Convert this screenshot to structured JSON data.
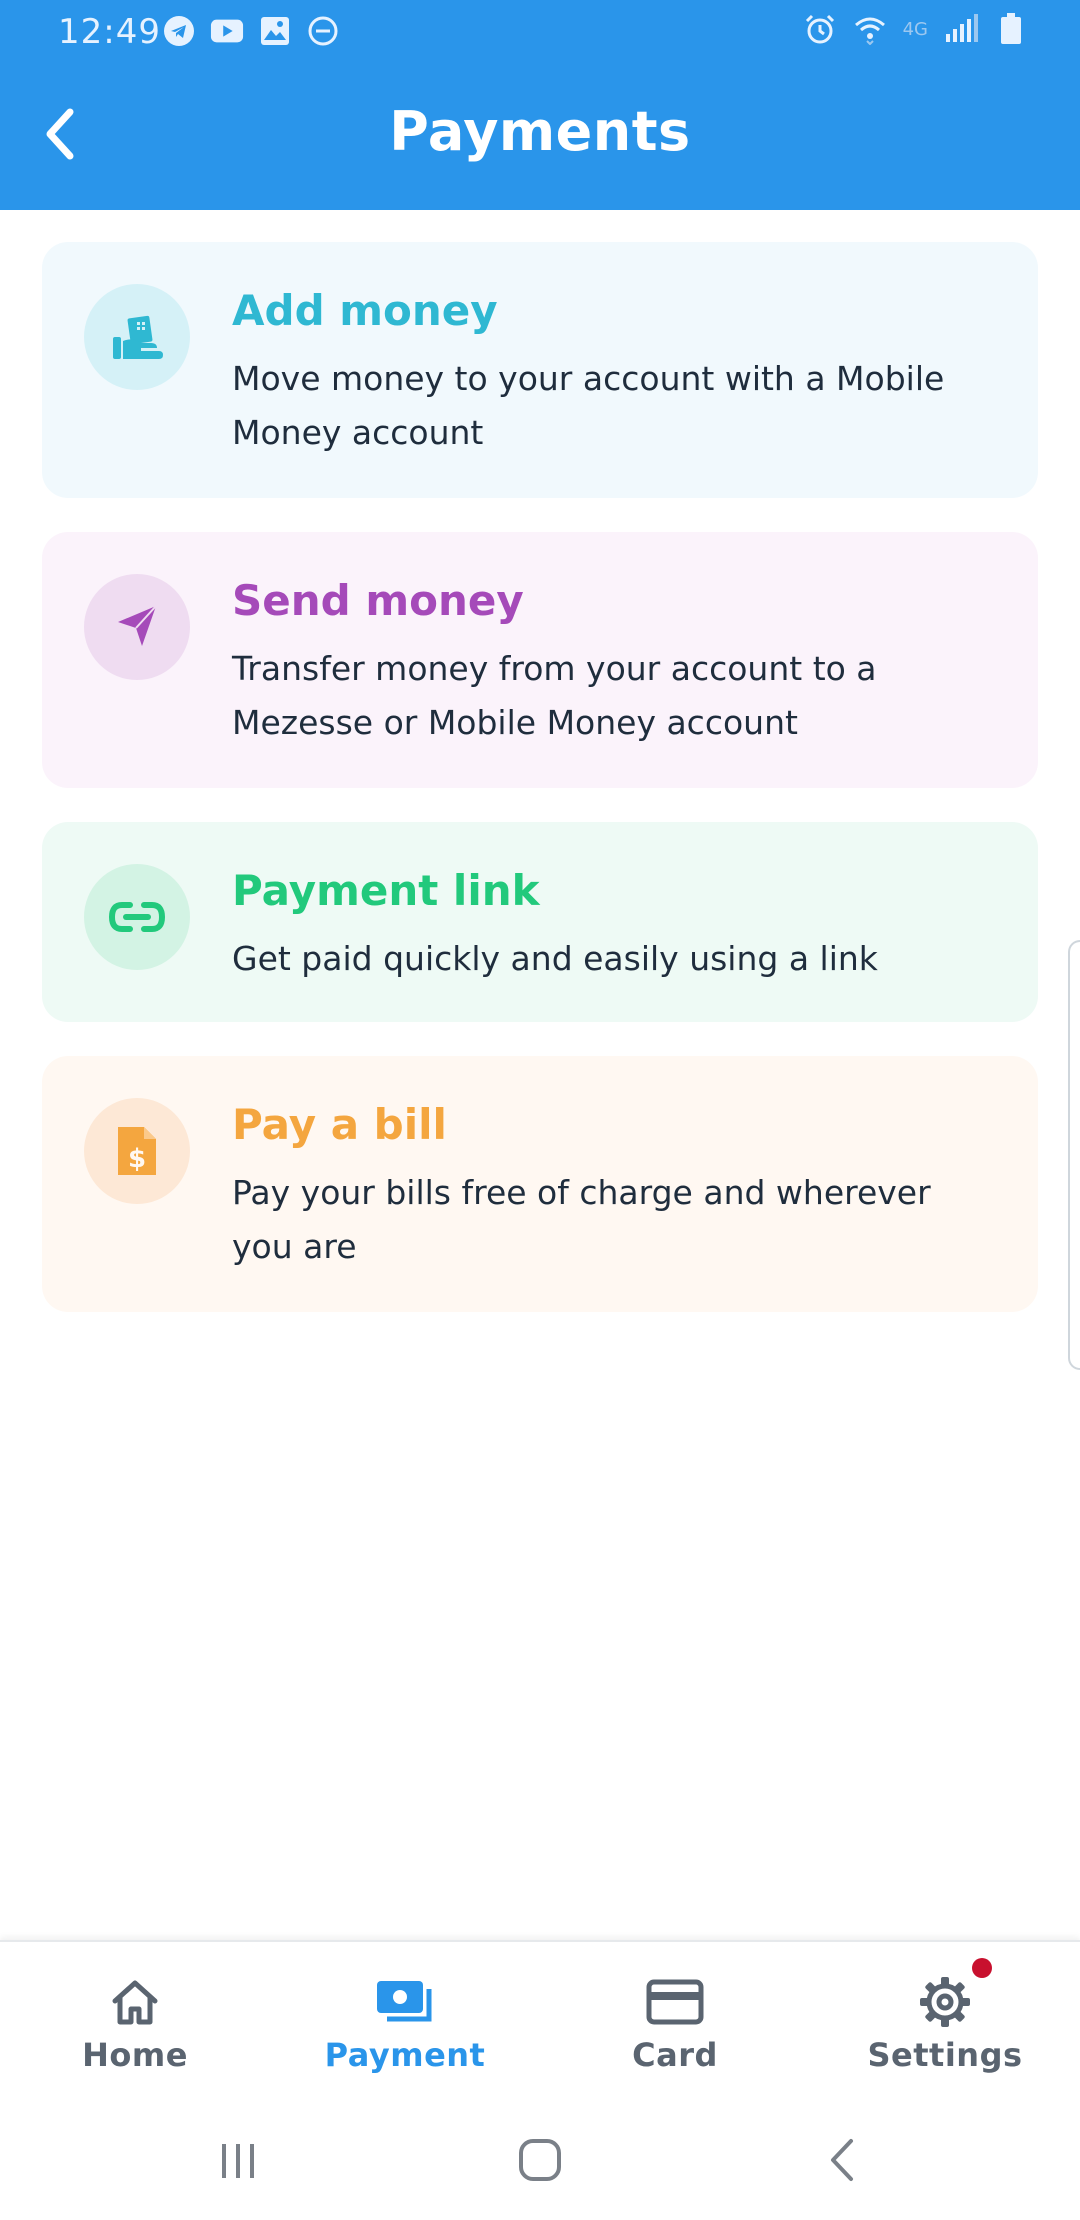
{
  "status_bar": {
    "time": "12:49",
    "left_icons": [
      "telegram-icon",
      "youtube-icon",
      "gallery-icon",
      "do-not-disturb-icon"
    ],
    "right_icons": [
      "alarm-icon",
      "wifi-icon",
      "network-4g-icon",
      "signal-icon",
      "battery-icon"
    ],
    "network_label": "4G"
  },
  "header": {
    "title": "Payments",
    "back_icon": "chevron-left-icon"
  },
  "cards": [
    {
      "title": "Add money",
      "description": "Move money to your account with a Mobile Money account",
      "icon": "hand-deposit-icon",
      "accent": "#2fb8d2"
    },
    {
      "title": "Send money",
      "description": "Transfer money from your account to a Mezesse or Mobile Money account",
      "icon": "send-arrow-icon",
      "accent": "#a54ab9"
    },
    {
      "title": "Payment link",
      "description": "Get paid quickly and easily using a link",
      "icon": "link-icon",
      "accent": "#22c97c"
    },
    {
      "title": "Pay a bill",
      "description": "Pay your bills free of charge and wherever you are",
      "icon": "bill-document-icon",
      "accent": "#f4a63f"
    }
  ],
  "bottom_nav": {
    "items": [
      {
        "label": "Home",
        "icon": "home-icon",
        "active": false
      },
      {
        "label": "Payment",
        "icon": "payment-icon",
        "active": true
      },
      {
        "label": "Card",
        "icon": "card-icon",
        "active": false
      },
      {
        "label": "Settings",
        "icon": "gear-icon",
        "active": false,
        "badge": true
      }
    ],
    "active_color": "#2a95ea",
    "badge_color": "#c8102e"
  },
  "system_nav": {
    "buttons": [
      "recents-icon",
      "home-circle-icon",
      "back-icon"
    ]
  },
  "colors": {
    "app_bar": "#2a95ea",
    "text": "#1f2d3d"
  }
}
